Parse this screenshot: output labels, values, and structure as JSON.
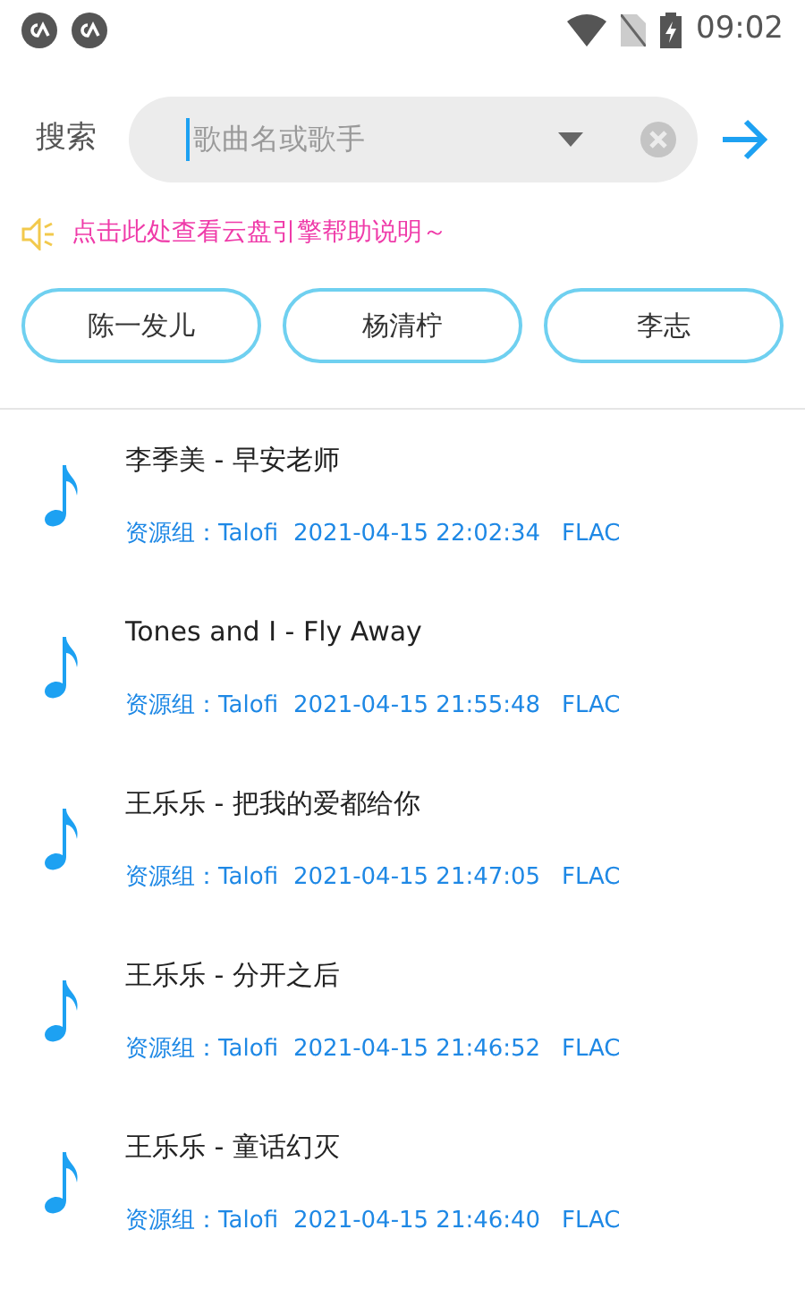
{
  "status_bar": {
    "time": "09:02"
  },
  "search": {
    "label": "搜索",
    "placeholder": "歌曲名或歌手"
  },
  "help_link": "点击此处查看云盘引擎帮助说明～",
  "artists": [
    "陈一发儿",
    "杨清柠",
    "李志"
  ],
  "songs": [
    {
      "title": "李季美 - 早安老师",
      "source": "资源组：Talofi",
      "time": "2021-04-15 22:02:34",
      "format": "FLAC"
    },
    {
      "title": "Tones and I - Fly Away",
      "source": "资源组：Talofi",
      "time": "2021-04-15 21:55:48",
      "format": "FLAC"
    },
    {
      "title": "王乐乐 - 把我的爱都给你",
      "source": "资源组：Talofi",
      "time": "2021-04-15 21:47:05",
      "format": "FLAC"
    },
    {
      "title": "王乐乐 - 分开之后",
      "source": "资源组：Talofi",
      "time": "2021-04-15 21:46:52",
      "format": "FLAC"
    },
    {
      "title": "王乐乐 - 童话幻灭",
      "source": "资源组：Talofi",
      "time": "2021-04-15 21:46:40",
      "format": "FLAC"
    }
  ]
}
